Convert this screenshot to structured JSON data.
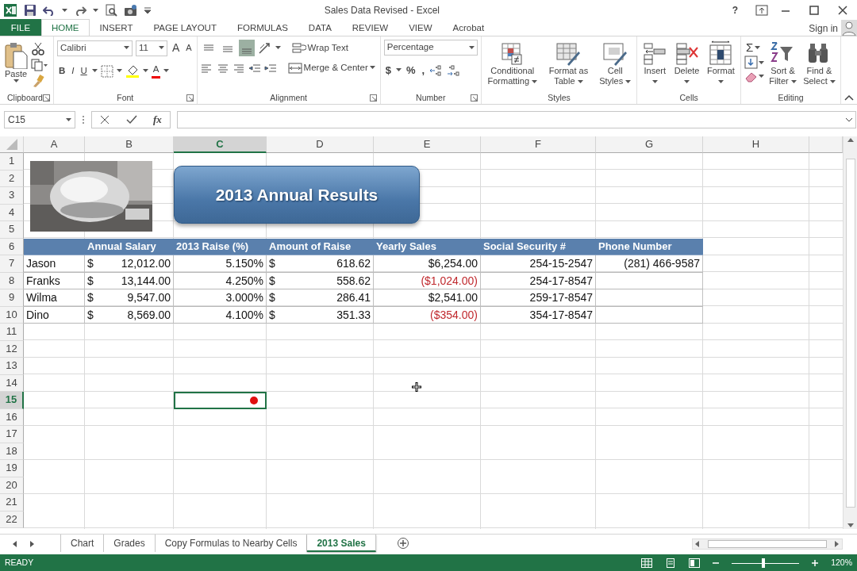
{
  "window": {
    "title": "Sales Data Revised - Excel",
    "help": "?"
  },
  "tabs": [
    {
      "label": "FILE",
      "kind": "file",
      "selected": false
    },
    {
      "label": "HOME",
      "kind": "tab",
      "selected": true
    },
    {
      "label": "INSERT",
      "kind": "tab",
      "selected": false
    },
    {
      "label": "PAGE LAYOUT",
      "kind": "tab",
      "selected": false
    },
    {
      "label": "FORMULAS",
      "kind": "tab",
      "selected": false
    },
    {
      "label": "DATA",
      "kind": "tab",
      "selected": false
    },
    {
      "label": "REVIEW",
      "kind": "tab",
      "selected": false
    },
    {
      "label": "VIEW",
      "kind": "tab",
      "selected": false
    },
    {
      "label": "Acrobat",
      "kind": "tab",
      "selected": false
    }
  ],
  "sign_in": "Sign in",
  "ribbon": {
    "groups": [
      {
        "kind": "clipboard",
        "label": "Clipboard",
        "launcher": true,
        "paste": "Paste"
      },
      {
        "kind": "font",
        "label": "Font",
        "launcher": true,
        "font_name": "Calibri",
        "font_size": "11",
        "grow": "A",
        "shrink": "A",
        "styles": [
          "B",
          "I",
          "U"
        ],
        "font_color": "A"
      },
      {
        "kind": "alignment",
        "label": "Alignment",
        "launcher": true,
        "vertical": [
          {
            "kind": "top",
            "selected": false
          },
          {
            "kind": "middle",
            "selected": false
          },
          {
            "kind": "bottom",
            "selected": true
          }
        ],
        "wrap": "Wrap Text",
        "merge": "Merge & Center"
      },
      {
        "kind": "number",
        "label": "Number",
        "launcher": true,
        "format": "Percentage",
        "symbols": [
          "$",
          "%",
          ","
        ]
      },
      {
        "kind": "large",
        "label": "Styles",
        "buttons": [
          {
            "label": "Conditional Formatting",
            "dropdown": true
          },
          {
            "label": "Format as Table",
            "dropdown": true
          },
          {
            "label": "Cell Styles",
            "dropdown": true
          }
        ]
      },
      {
        "kind": "large",
        "label": "Cells",
        "buttons": [
          {
            "label": "Insert",
            "dropdown": true
          },
          {
            "label": "Delete",
            "dropdown": true
          },
          {
            "label": "Format",
            "dropdown": true
          }
        ]
      },
      {
        "kind": "editing",
        "label": "Editing",
        "autosum": "Σ",
        "buttons": [
          {
            "label": "Sort & Filter",
            "dropdown": true
          },
          {
            "label": "Find & Select",
            "dropdown": true
          }
        ]
      }
    ]
  },
  "formula_bar": {
    "name_box": "C15",
    "fx": "fx"
  },
  "sheet": {
    "columns": [
      {
        "label": "A",
        "selected": false
      },
      {
        "label": "B",
        "selected": false
      },
      {
        "label": "C",
        "selected": true
      },
      {
        "label": "D",
        "selected": false
      },
      {
        "label": "E",
        "selected": false
      },
      {
        "label": "F",
        "selected": false
      },
      {
        "label": "G",
        "selected": false
      },
      {
        "label": "H",
        "selected": false
      }
    ],
    "rows": [
      {
        "label": "1",
        "selected": false
      },
      {
        "label": "2",
        "selected": false
      },
      {
        "label": "3",
        "selected": false
      },
      {
        "label": "4",
        "selected": false
      },
      {
        "label": "5",
        "selected": false
      },
      {
        "label": "6",
        "selected": false
      },
      {
        "label": "7",
        "selected": false
      },
      {
        "label": "8",
        "selected": false
      },
      {
        "label": "9",
        "selected": false
      },
      {
        "label": "10",
        "selected": false
      },
      {
        "label": "11",
        "selected": false
      },
      {
        "label": "12",
        "selected": false
      },
      {
        "label": "13",
        "selected": false
      },
      {
        "label": "14",
        "selected": false
      },
      {
        "label": "15",
        "selected": true
      },
      {
        "label": "16",
        "selected": false
      },
      {
        "label": "17",
        "selected": false
      },
      {
        "label": "18",
        "selected": false
      },
      {
        "label": "19",
        "selected": false
      },
      {
        "label": "20",
        "selected": false
      },
      {
        "label": "21",
        "selected": false
      },
      {
        "label": "22",
        "selected": false
      }
    ],
    "banner": "2013 Annual Results",
    "table": {
      "headers": [
        "Annual Salary",
        "2013 Raise (%)",
        "Amount of Raise",
        "Yearly Sales",
        "Social Security #",
        "Phone Number"
      ],
      "rows": [
        {
          "name": "Jason",
          "salary": {
            "symbol": "$",
            "value": "12,012.00"
          },
          "raise": "5.150%",
          "amount": {
            "symbol": "$",
            "value": "618.62"
          },
          "sales": {
            "text": "$6,254.00",
            "negative": false
          },
          "ssn": "254-15-2547",
          "phone": "(281) 466-9587"
        },
        {
          "name": "Franks",
          "salary": {
            "symbol": "$",
            "value": "13,144.00"
          },
          "raise": "4.250%",
          "amount": {
            "symbol": "$",
            "value": "558.62"
          },
          "sales": {
            "text": "($1,024.00)",
            "negative": true
          },
          "ssn": "254-17-8547"
        },
        {
          "name": "Wilma",
          "salary": {
            "symbol": "$",
            "value": "9,547.00"
          },
          "raise": "3.000%",
          "amount": {
            "symbol": "$",
            "value": "286.41"
          },
          "sales": {
            "text": "$2,541.00",
            "negative": false
          },
          "ssn": "259-17-8547"
        },
        {
          "name": "Dino",
          "salary": {
            "symbol": "$",
            "value": "8,569.00"
          },
          "raise": "4.100%",
          "amount": {
            "symbol": "$",
            "value": "351.33"
          },
          "sales": {
            "text": "($354.00)",
            "negative": true
          },
          "ssn": "354-17-8547"
        }
      ]
    }
  },
  "sheet_tabs": [
    {
      "label": "Chart",
      "selected": false
    },
    {
      "label": "Grades",
      "selected": false
    },
    {
      "label": "Copy Formulas to Nearby Cells",
      "selected": false
    },
    {
      "label": "2013 Sales",
      "selected": true
    }
  ],
  "status_bar": {
    "status": "READY",
    "zoom": "120%",
    "zoom_slider": {
      "level": 0.47
    }
  }
}
